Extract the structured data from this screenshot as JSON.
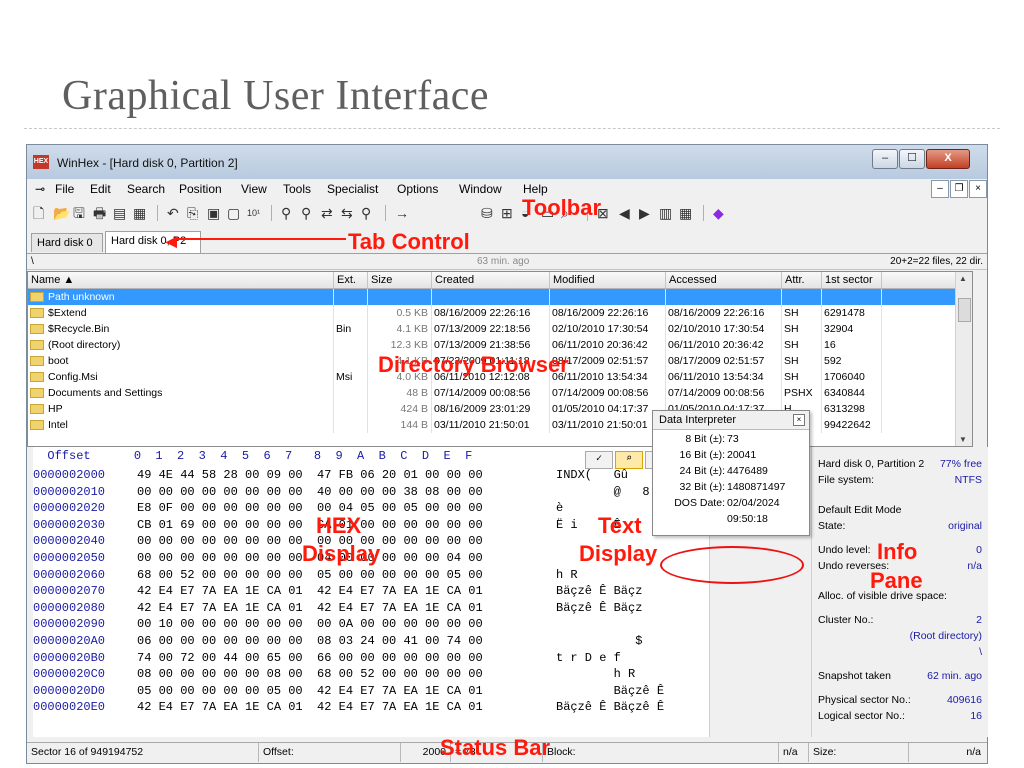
{
  "slide": {
    "title": "Graphical User Interface"
  },
  "window": {
    "title": "WinHex - [Hard disk 0, Partition 2]",
    "app_icon_text": "HEX",
    "controls": {
      "minimize": "–",
      "maximize": "☐",
      "close": "X"
    }
  },
  "menu": {
    "items": [
      "File",
      "Edit",
      "Search",
      "Position",
      "View",
      "Tools",
      "Specialist",
      "Options",
      "Window",
      "Help"
    ],
    "mdi": {
      "minimize": "–",
      "restore": "❐",
      "close": "×"
    }
  },
  "toolbar": {
    "icons": [
      "new-file-icon",
      "open-icon",
      "save-icon",
      "print-icon",
      "properties-icon",
      "open-folder-icon",
      "undo-icon",
      "copy-icon",
      "paste-icon",
      "paste-special-icon",
      "hex-convert-icon",
      "find-icon",
      "find-hex-icon",
      "replace-icon",
      "replace-hex-icon",
      "find-next-icon",
      "goto-icon",
      "disk-icon",
      "network-icon",
      "ram-icon",
      "zoom-icon",
      "calculator-icon",
      "back-icon",
      "forward-icon",
      "snapshot-icon",
      "grid-icon",
      "help-icon"
    ]
  },
  "tabs": [
    {
      "label": "Hard disk 0"
    },
    {
      "label": "Hard disk 0, P2"
    }
  ],
  "pathbar": {
    "path": "\\",
    "age": "63 min. ago",
    "count": "20+2=22 files, 22 dir."
  },
  "directory": {
    "columns": [
      "Name ▲",
      "Ext.",
      "Size",
      "Created",
      "Modified",
      "Accessed",
      "Attr.",
      "1st sector"
    ],
    "rows": [
      {
        "name": "Path unknown",
        "ext": "",
        "size": "",
        "created": "",
        "modified": "",
        "accessed": "",
        "attr": "",
        "sector": "",
        "selected": true
      },
      {
        "name": "$Extend",
        "ext": "",
        "size": "0.5 KB",
        "created": "08/16/2009  22:26:16",
        "modified": "08/16/2009  22:26:16",
        "accessed": "08/16/2009  22:26:16",
        "attr": "SH",
        "sector": "6291478"
      },
      {
        "name": "$Recycle.Bin",
        "ext": "Bin",
        "size": "4.1 KB",
        "created": "07/13/2009  22:18:56",
        "modified": "02/10/2010  17:30:54",
        "accessed": "02/10/2010  17:30:54",
        "attr": "SH",
        "sector": "32904"
      },
      {
        "name": "(Root directory)",
        "ext": "",
        "size": "12.3 KB",
        "created": "07/13/2009  21:38:56",
        "modified": "06/11/2010  20:36:42",
        "accessed": "06/11/2010  20:36:42",
        "attr": "SH",
        "sector": "16"
      },
      {
        "name": "boot",
        "ext": "",
        "size": "4.1 KB",
        "created": "07/23/2009  01:11:18",
        "modified": "08/17/2009  02:51:57",
        "accessed": "08/17/2009  02:51:57",
        "attr": "SH",
        "sector": "592"
      },
      {
        "name": "Config.Msi",
        "ext": "Msi",
        "size": "4.0 KB",
        "created": "06/11/2010  12:12:08",
        "modified": "06/11/2010  13:54:34",
        "accessed": "06/11/2010  13:54:34",
        "attr": "SH",
        "sector": "1706040"
      },
      {
        "name": "Documents and Settings",
        "ext": "",
        "size": "48 B",
        "created": "07/14/2009  00:08:56",
        "modified": "07/14/2009  00:08:56",
        "accessed": "07/14/2009  00:08:56",
        "attr": "PSHX",
        "sector": "6340844"
      },
      {
        "name": "HP",
        "ext": "",
        "size": "424 B",
        "created": "08/16/2009  23:01:29",
        "modified": "01/05/2010  04:17:37",
        "accessed": "01/05/2010  04:17:37",
        "attr": "H",
        "sector": "6313298"
      },
      {
        "name": "Intel",
        "ext": "",
        "size": "144 B",
        "created": "03/11/2010  21:50:01",
        "modified": "03/11/2010  21:50:01",
        "accessed": "03/11/2010  21:50:01",
        "attr": "",
        "sector": "99422642"
      }
    ]
  },
  "hex": {
    "header": "  Offset      0  1  2  3  4  5  6  7   8  9  A  B  C  D  E  F",
    "rows": [
      {
        "offset": "0000002000",
        "bytes": "49 4E 44 58 28 00 09 00  47 FB 06 20 01 00 00 00",
        "text": "INDX(   Gû"
      },
      {
        "offset": "0000002010",
        "bytes": "00 00 00 00 00 00 00 00  40 00 00 00 38 08 00 00",
        "text": "        @   8"
      },
      {
        "offset": "0000002020",
        "bytes": "E8 0F 00 00 00 00 00 00  00 04 05 00 05 00 00 00",
        "text": "è"
      },
      {
        "offset": "0000002030",
        "bytes": "CB 01 69 00 00 00 00 00  CA 01 00 00 00 00 00 00",
        "text": "Ë i     Ê"
      },
      {
        "offset": "0000002040",
        "bytes": "00 00 00 00 00 00 00 00  00 00 00 00 00 00 00 00",
        "text": ""
      },
      {
        "offset": "0000002050",
        "bytes": "00 00 00 00 00 00 00 00  04 00 00 00 00 00 04 00",
        "text": ""
      },
      {
        "offset": "0000002060",
        "bytes": "68 00 52 00 00 00 00 00  05 00 00 00 00 00 05 00",
        "text": "h R"
      },
      {
        "offset": "0000002070",
        "bytes": "42 E4 E7 7A EA 1E CA 01  42 E4 E7 7A EA 1E CA 01",
        "text": "Bäçzê Ê Bäçz"
      },
      {
        "offset": "0000002080",
        "bytes": "42 E4 E7 7A EA 1E CA 01  42 E4 E7 7A EA 1E CA 01",
        "text": "Bäçzê Ê Bäçz"
      },
      {
        "offset": "0000002090",
        "bytes": "00 10 00 00 00 00 00 00  00 0A 00 00 00 00 00 00",
        "text": ""
      },
      {
        "offset": "00000020A0",
        "bytes": "06 00 00 00 00 00 00 00  08 03 24 00 41 00 74 00",
        "text": "           $"
      },
      {
        "offset": "00000020B0",
        "bytes": "74 00 72 00 44 00 65 00  66 00 00 00 00 00 00 00",
        "text": "t r D e f"
      },
      {
        "offset": "00000020C0",
        "bytes": "08 00 00 00 00 00 08 00  68 00 52 00 00 00 00 00",
        "text": "        h R"
      },
      {
        "offset": "00000020D0",
        "bytes": "05 00 00 00 00 00 05 00  42 E4 E7 7A EA 1E CA 01",
        "text": "        Bäçzê Ê"
      },
      {
        "offset": "00000020E0",
        "bytes": "42 E4 E7 7A EA 1E CA 01  42 E4 E7 7A EA 1E CA 01",
        "text": "Bäçzê Ê Bäçzê Ê"
      }
    ]
  },
  "info_pane": {
    "rows": [
      {
        "label": "Hard disk 0, Partition 2",
        "value": "77% free"
      },
      {
        "label": "File system:",
        "value": "NTFS"
      },
      {
        "label": "Default Edit Mode",
        "value": ""
      },
      {
        "label": "State:",
        "value": "original"
      },
      {
        "label": "Undo level:",
        "value": "0"
      },
      {
        "label": "Undo reverses:",
        "value": "n/a"
      },
      {
        "label": "Alloc. of visible drive space:",
        "value": ""
      },
      {
        "label": "Cluster No.:",
        "value": "2"
      },
      {
        "label": "",
        "value": "(Root directory)"
      },
      {
        "label": "",
        "value": "\\"
      },
      {
        "label": "Snapshot taken",
        "value": "62 min. ago"
      },
      {
        "label": "Physical sector No.:",
        "value": "409616"
      },
      {
        "label": "Logical sector No.:",
        "value": "16"
      }
    ]
  },
  "data_interpreter": {
    "title": "Data Interpreter",
    "rows": [
      {
        "key": "8 Bit (±):",
        "value": "73"
      },
      {
        "key": "16 Bit (±):",
        "value": "20041"
      },
      {
        "key": "24 Bit (±):",
        "value": "4476489"
      },
      {
        "key": "32 Bit (±):",
        "value": "1480871497"
      },
      {
        "key": "DOS Date:",
        "value": "02/04/2024"
      },
      {
        "key": "",
        "value": "09:50:18"
      }
    ]
  },
  "status": {
    "sector": "Sector 16 of 949194752",
    "offset_label": "Offset:",
    "offset_value": "2000",
    "equals": "= 73",
    "block_label": "Block:",
    "block_value": "n/a",
    "size_label": "Size:",
    "size_value": "n/a"
  },
  "annotations": {
    "toolbar": "Toolbar",
    "tab_control": "Tab Control",
    "directory_browser": "Directory Browser",
    "hex_display_1": "HEX",
    "hex_display_2": "Display",
    "text_display_1": "Text",
    "text_display_2": "Display",
    "info_pane_1": "Info",
    "info_pane_2": "Pane",
    "status_bar": "Status Bar"
  },
  "colors": {
    "annotation": "#ff1a0d",
    "selection": "#3399ff",
    "hex_offset": "#1a1aa6"
  }
}
